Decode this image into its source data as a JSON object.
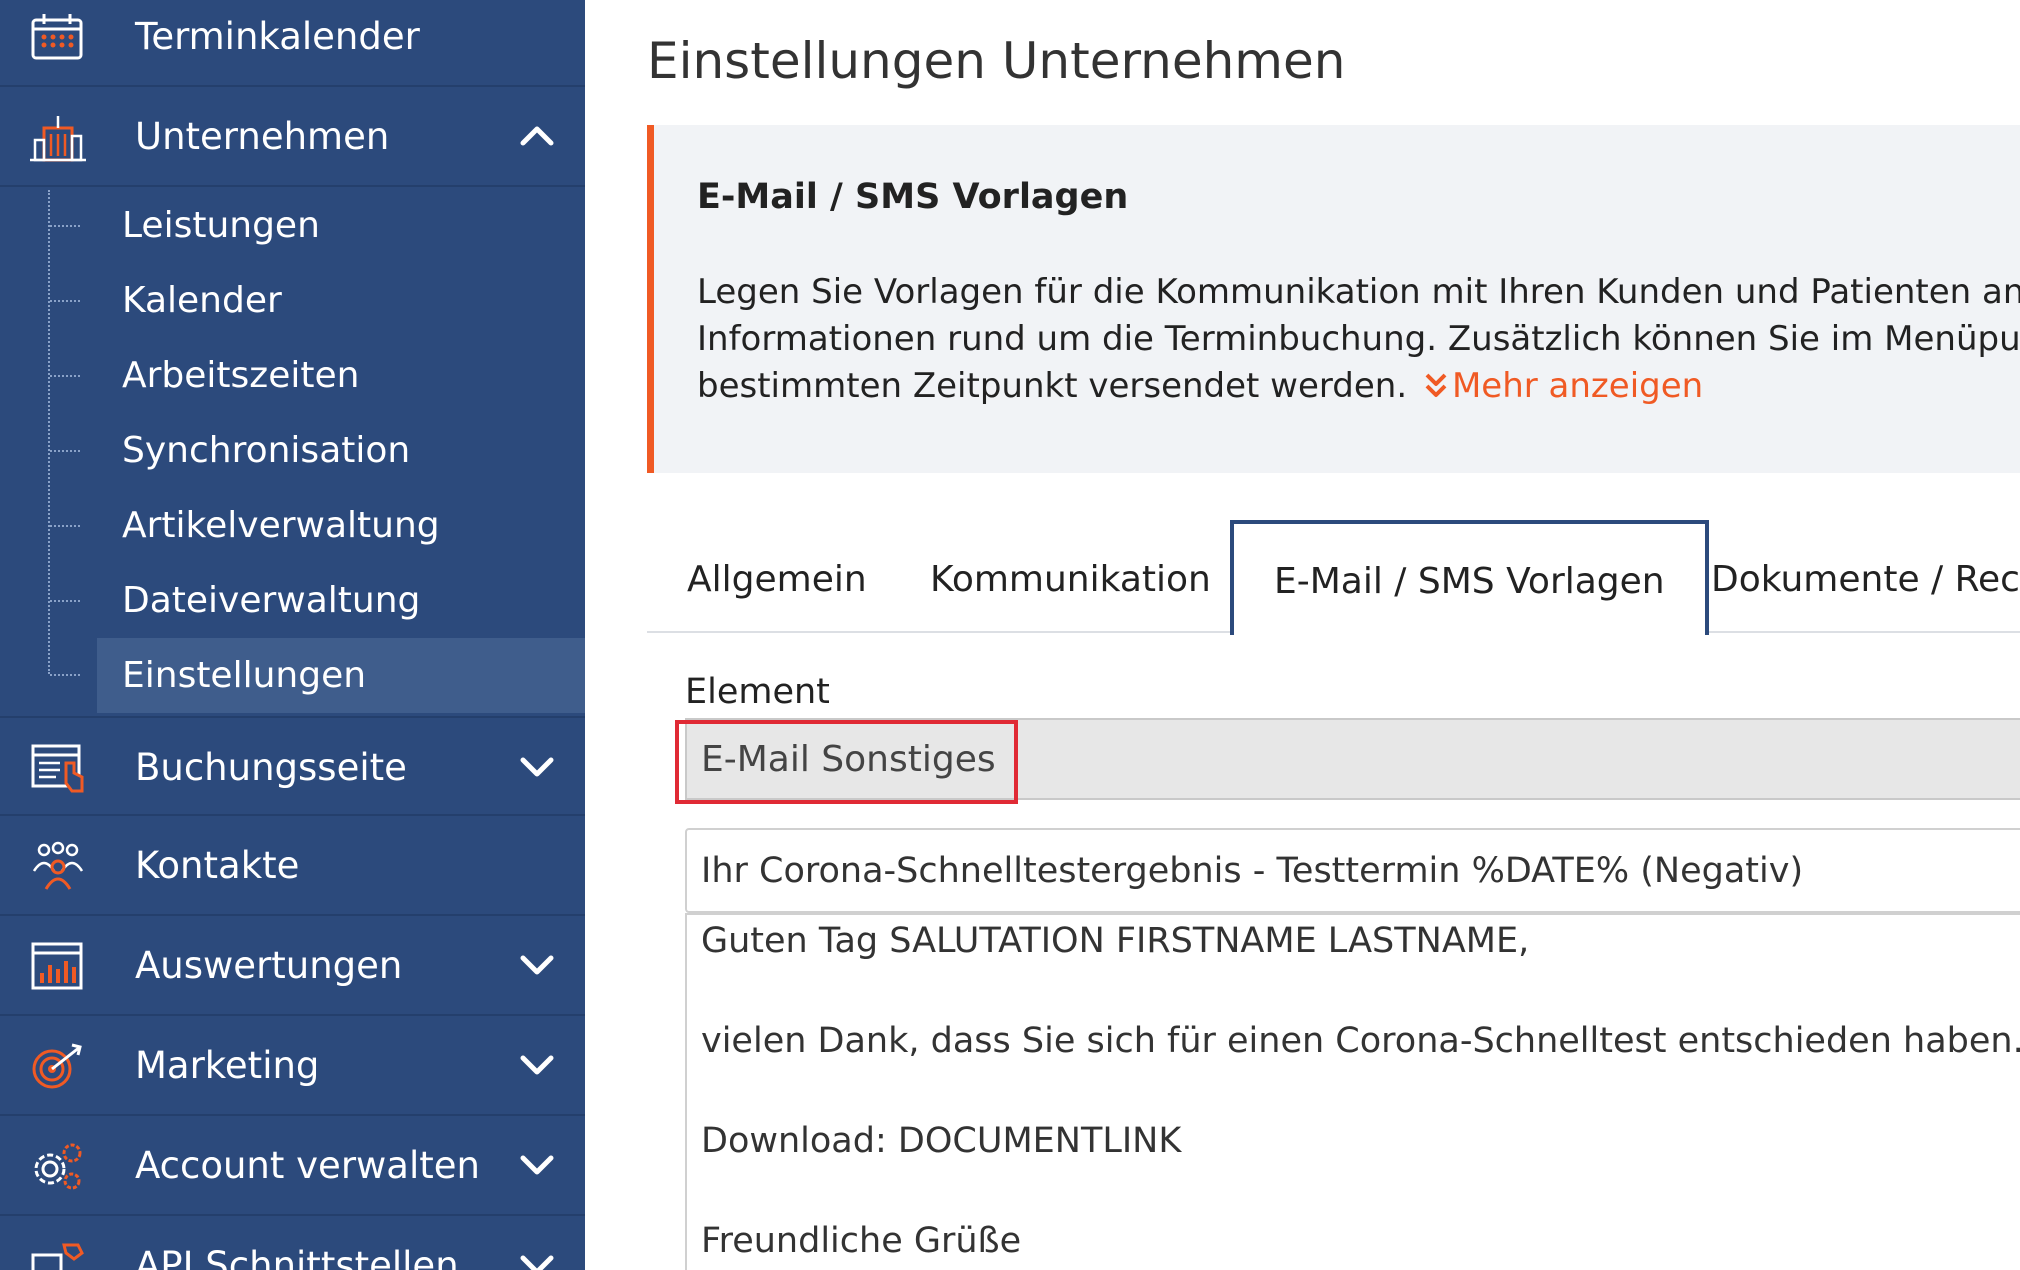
{
  "sidebar": {
    "items": [
      {
        "label": "Terminkalender",
        "icon": "calendar-icon"
      },
      {
        "label": "Unternehmen",
        "icon": "building-icon",
        "expanded": true
      },
      {
        "label": "Buchungsseite",
        "icon": "booking-page-icon"
      },
      {
        "label": "Kontakte",
        "icon": "contacts-icon"
      },
      {
        "label": "Auswertungen",
        "icon": "statistics-icon"
      },
      {
        "label": "Marketing",
        "icon": "target-icon"
      },
      {
        "label": "Account verwalten",
        "icon": "gears-icon"
      },
      {
        "label": "API Schnittstellen",
        "icon": "api-icon"
      }
    ],
    "subitems": [
      {
        "label": "Leistungen"
      },
      {
        "label": "Kalender"
      },
      {
        "label": "Arbeitszeiten"
      },
      {
        "label": "Synchronisation"
      },
      {
        "label": "Artikelverwaltung"
      },
      {
        "label": "Dateiverwaltung"
      },
      {
        "label": "Einstellungen",
        "active": true
      }
    ]
  },
  "page": {
    "title": "Einstellungen Unternehmen"
  },
  "info": {
    "title": "E-Mail / SMS Vorlagen",
    "line1": "Legen Sie Vorlagen für die Kommunikation mit Ihren Kunden und Patienten an. Nu",
    "line2": "Informationen rund um die Terminbuchung. Zusätzlich können Sie im Menüpunkt",
    "line3": "bestimmten Zeitpunkt versendet werden.",
    "more_label": "Mehr anzeigen",
    "more_icon": "double-chevron-down-icon"
  },
  "tabs": [
    {
      "label": "Allgemein"
    },
    {
      "label": "Kommunikation"
    },
    {
      "label": "E-Mail / SMS Vorlagen",
      "active": true
    },
    {
      "label": "Dokumente / Rechn"
    }
  ],
  "form": {
    "element_label": "Element",
    "element_value": "E-Mail Sonstiges",
    "subject_value": "Ihr Corona-Schnelltestergebnis - Testtermin %DATE% (Negativ)",
    "body_lines": [
      "Guten Tag SALUTATION FIRSTNAME LASTNAME,",
      "vielen Dank, dass Sie sich für einen Corona-Schnelltest entschieden haben. Über d",
      "Download: DOCUMENTLINK",
      "Freundliche Grüße"
    ]
  },
  "colors": {
    "sidebar_bg": "#2c4a7c",
    "sidebar_active": "#3f5d8c",
    "accent_orange": "#f05a24",
    "highlight_red": "#e02a35",
    "info_bg": "#f1f3f6"
  }
}
